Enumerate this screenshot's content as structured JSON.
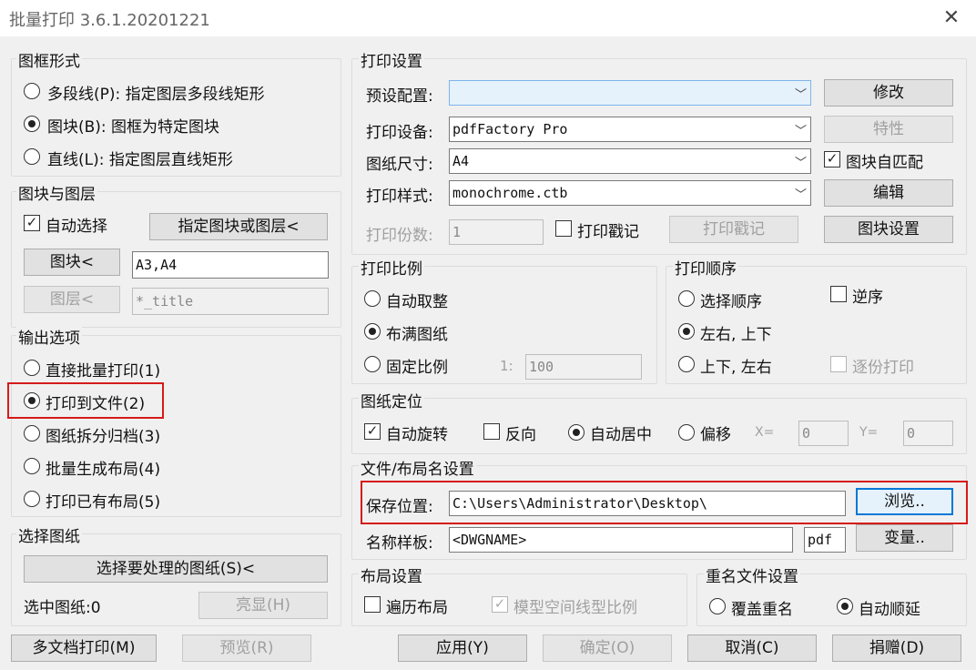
{
  "window": {
    "title": "批量打印 3.6.1.20201221"
  },
  "frame_form": {
    "title": "图框形式",
    "options": [
      "多段线(P): 指定图层多段线矩形",
      "图块(B): 图框为特定图块",
      "直线(L): 指定图层直线矩形"
    ]
  },
  "block_layer": {
    "title": "图块与图层",
    "auto_select": "自动选择",
    "specify_button": "指定图块或图层<",
    "block_button": "图块<",
    "block_value": "A3,A4",
    "layer_button": "图层<",
    "layer_value": "*_title"
  },
  "output": {
    "title": "输出选项",
    "options": [
      "直接批量打印(1)",
      "打印到文件(2)",
      "图纸拆分归档(3)",
      "批量生成布局(4)",
      "打印已有布局(5)"
    ]
  },
  "select_sheet": {
    "title": "选择图纸",
    "select_button": "选择要处理的图纸(S)<",
    "selected_label": "选中图纸:0",
    "highlight_button": "亮显(H)"
  },
  "print_settings": {
    "title": "打印设置",
    "preset_label": "预设配置:",
    "preset_value": "",
    "modify_button": "修改",
    "device_label": "打印设备:",
    "device_value": "pdfFactory Pro",
    "properties_button": "特性",
    "paper_label": "图纸尺寸:",
    "paper_value": "A4",
    "block_match": "图块自匹配",
    "style_label": "打印样式:",
    "style_value": "monochrome.ctb",
    "edit_button": "编辑",
    "copies_label": "打印份数:",
    "copies_value": "1",
    "stamp_check": "打印戳记",
    "stamp_button": "打印戳记",
    "block_settings_button": "图块设置"
  },
  "scale": {
    "title": "打印比例",
    "options": [
      "自动取整",
      "布满图纸",
      "固定比例"
    ],
    "ratio_prefix": "1:",
    "ratio_value": "100"
  },
  "order": {
    "title": "打印顺序",
    "select_order": "选择顺序",
    "reverse": "逆序",
    "lr_tb": "左右, 上下",
    "tb_lr": "上下, 左右",
    "collate": "逐份打印"
  },
  "position": {
    "title": "图纸定位",
    "auto_rotate": "自动旋转",
    "reverse": "反向",
    "auto_center": "自动居中",
    "offset": "偏移",
    "x_label": "X=",
    "x_value": "0",
    "y_label": "Y=",
    "y_value": "0"
  },
  "file_naming": {
    "title": "文件/布局名设置",
    "save_label": "保存位置:",
    "save_value": "C:\\Users\\Administrator\\Desktop\\",
    "browse_button": "浏览..",
    "template_label": "名称样板:",
    "template_value": "<DWGNAME>",
    "ext_value": "pdf",
    "variables_button": "变量.."
  },
  "layout": {
    "title": "布局设置",
    "traverse": "遍历布局",
    "model_linetype": "模型空间线型比例"
  },
  "rename": {
    "title": "重名文件设置",
    "overwrite": "覆盖重名",
    "auto_increment": "自动顺延"
  },
  "footer": {
    "multi_doc": "多文档打印(M)",
    "preview": "预览(R)",
    "apply": "应用(Y)",
    "ok": "确定(O)",
    "cancel": "取消(C)",
    "donate": "捐赠(D)"
  },
  "colors": {
    "highlight_red": "#d61a1a",
    "focus_blue": "#0078d7"
  }
}
